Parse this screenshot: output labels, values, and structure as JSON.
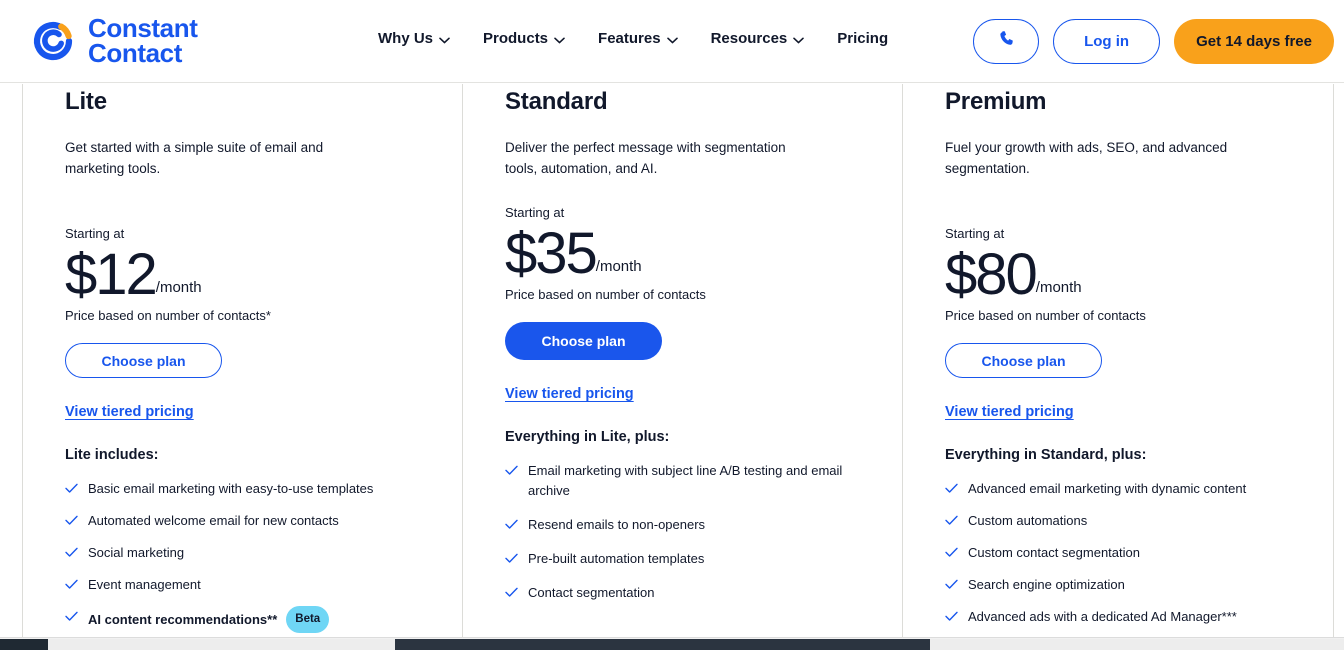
{
  "brand": {
    "name_line1": "Constant",
    "name_line2": "Contact",
    "logo_blue": "#1856ed",
    "logo_orange": "#f9a11b"
  },
  "header": {
    "nav": [
      {
        "label": "Why Us",
        "has_dropdown": true
      },
      {
        "label": "Products",
        "has_dropdown": true
      },
      {
        "label": "Features",
        "has_dropdown": true
      },
      {
        "label": "Resources",
        "has_dropdown": true
      },
      {
        "label": "Pricing",
        "has_dropdown": false
      }
    ],
    "phone_icon": "phone-icon",
    "login_label": "Log in",
    "trial_label": "Get 14 days free",
    "accent_blue": "#1856ed",
    "accent_orange": "#f9a11b"
  },
  "plans": [
    {
      "name": "Lite",
      "description": "Get started with a simple suite of email and marketing tools.",
      "starting_label": "Starting at",
      "price": "$12",
      "period": "/month",
      "price_note": "Price based on number of contacts*",
      "cta_label": "Choose plan",
      "cta_style": "outline",
      "tiered_link": "View tiered pricing",
      "includes_heading": "Lite includes:",
      "features": [
        {
          "text": "Basic email marketing with easy-to-use templates",
          "bold": false
        },
        {
          "text": "Automated welcome email for new contacts",
          "bold": false
        },
        {
          "text": "Social marketing",
          "bold": false
        },
        {
          "text": "Event management",
          "bold": false
        },
        {
          "text": "AI content recommendations**",
          "bold": true,
          "badge": "Beta"
        }
      ]
    },
    {
      "name": "Standard",
      "description": "Deliver the perfect message with segmentation tools, automation, and AI.",
      "starting_label": "Starting at",
      "price": "$35",
      "period": "/month",
      "price_note": "Price based on number of contacts",
      "cta_label": "Choose plan",
      "cta_style": "filled",
      "tiered_link": "View tiered pricing",
      "includes_heading": "Everything in Lite, plus:",
      "features": [
        {
          "text": "Email marketing with subject line A/B testing and email archive",
          "bold": false
        },
        {
          "text": "Resend emails to non-openers",
          "bold": false
        },
        {
          "text": "Pre-built automation templates",
          "bold": false
        },
        {
          "text": "Contact segmentation",
          "bold": false
        }
      ]
    },
    {
      "name": "Premium",
      "description": "Fuel your growth with ads, SEO, and advanced segmentation.",
      "starting_label": "Starting at",
      "price": "$80",
      "period": "/month",
      "price_note": "Price based on number of contacts",
      "cta_label": "Choose plan",
      "cta_style": "outline",
      "tiered_link": "View tiered pricing",
      "includes_heading": "Everything in Standard, plus:",
      "features": [
        {
          "text": "Advanced email marketing with dynamic content",
          "bold": false
        },
        {
          "text": "Custom automations",
          "bold": false
        },
        {
          "text": "Custom contact segmentation",
          "bold": false
        },
        {
          "text": "Search engine optimization",
          "bold": false
        },
        {
          "text": "Advanced ads with a dedicated Ad Manager***",
          "bold": false
        }
      ]
    }
  ],
  "colors": {
    "check_blue": "#1856ed",
    "badge_bg": "#6fd6f5",
    "divider": "#dcdcd8",
    "text": "#11182b"
  }
}
